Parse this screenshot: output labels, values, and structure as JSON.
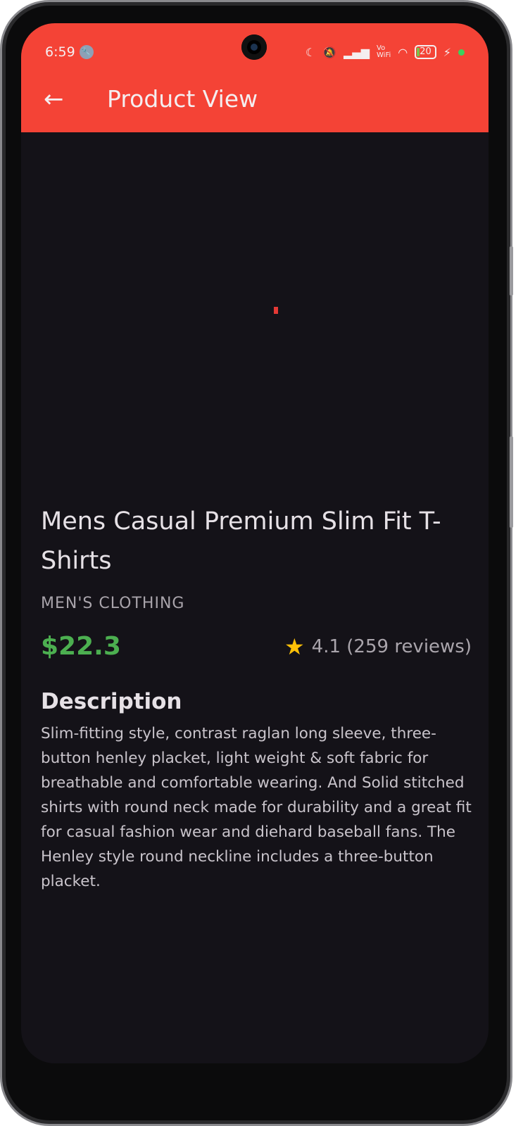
{
  "status_bar": {
    "time": "6:59",
    "icons": [
      "wrench-icon",
      "moon-icon",
      "bell-off-icon",
      "signal-icon",
      "vowifi-icon",
      "wifi-icon",
      "battery-icon",
      "charging-icon",
      "green-dot-icon"
    ],
    "vowifi": "Vo\nWiFi",
    "battery": "20"
  },
  "app_bar": {
    "title": "Product View",
    "back_icon": "arrow-left-icon"
  },
  "product": {
    "name": "Mens Casual Premium Slim Fit T-Shirts",
    "category": "MEN'S CLOTHING",
    "price": "$22.3",
    "rating": "4.1 (259 reviews)",
    "description_heading": "Description",
    "description": "Slim-fitting style, contrast raglan long sleeve, three-button henley placket, light weight & soft fabric for breathable and comfortable wearing. And Solid stitched shirts with round neck made for durability and a great fit for casual fashion wear and diehard baseball fans. The Henley style round neckline includes a three-button placket."
  },
  "colors": {
    "accent": "#f44336",
    "price": "#4caf50",
    "star": "#ffc107",
    "background": "#141218"
  }
}
